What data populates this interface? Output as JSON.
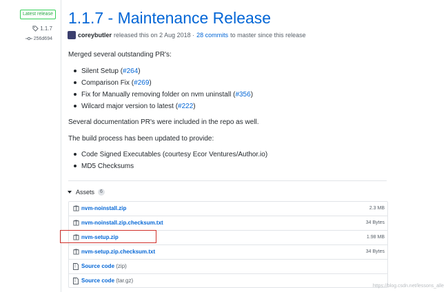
{
  "sidebar": {
    "badge": "Latest release",
    "tag": "1.1.7",
    "commit": "256d694"
  },
  "release": {
    "title": "1.1.7 - Maintenance Release",
    "author": "coreybutler",
    "released_text": "released this on 2 Aug 2018 ·",
    "commits_link": "28 commits",
    "commits_suffix": "to master since this release"
  },
  "body": {
    "intro": "Merged several outstanding PR's:",
    "prs": [
      {
        "text": "Silent Setup (",
        "link": "#264",
        "close": ")"
      },
      {
        "text": "Comparison Fix (",
        "link": "#269",
        "close": ")"
      },
      {
        "text": "Fix for Manually removing folder on nvm uninstall (",
        "link": "#356",
        "close": ")"
      },
      {
        "text": "Wilcard major version to latest (",
        "link": "#222",
        "close": ")"
      }
    ],
    "docs_note": "Several documentation PR's were included in the repo as well.",
    "build_note": "The build process has been updated to provide:",
    "build_items": [
      "Code Signed Executables (courtesy Ecor Ventures/Author.io)",
      "MD5 Checksums"
    ]
  },
  "assets": {
    "heading": "Assets",
    "count": "6",
    "files": [
      {
        "name": "nvm-noinstall.zip",
        "size": "2.3 MB"
      },
      {
        "name": "nvm-noinstall.zip.checksum.txt",
        "size": "34 Bytes"
      },
      {
        "name": "nvm-setup.zip",
        "size": "1.98 MB"
      },
      {
        "name": "nvm-setup.zip.checksum.txt",
        "size": "34 Bytes"
      }
    ],
    "sources": [
      {
        "name": "Source code",
        "fmt": "(zip)"
      },
      {
        "name": "Source code",
        "fmt": "(tar.gz)"
      }
    ]
  },
  "watermark": "https://blog.csdn.net/lessons_alle",
  "colors": {
    "link": "#0366d6",
    "badge_green": "#28a745",
    "highlight_red": "#d0302a"
  }
}
